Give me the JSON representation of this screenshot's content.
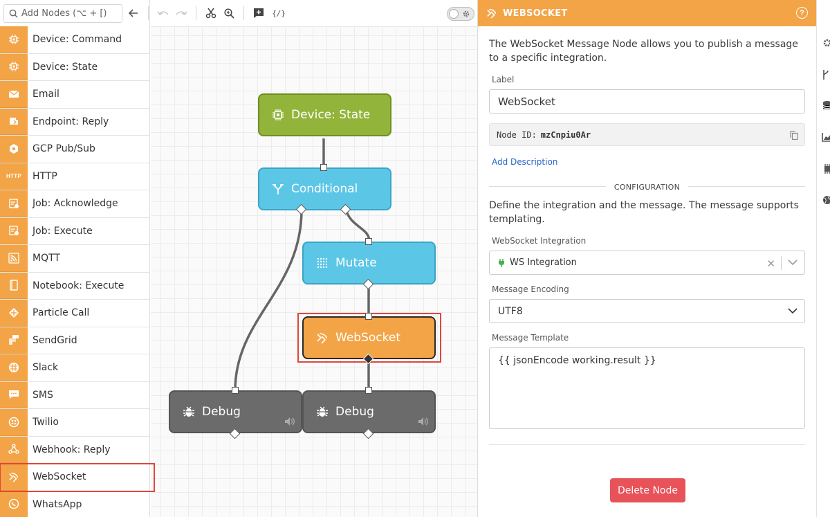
{
  "palette": {
    "search": {
      "placeholder": "Add Nodes (⌥ + [)"
    },
    "items": [
      {
        "label": "Device: Command",
        "icon": "chip-icon"
      },
      {
        "label": "Device: State",
        "icon": "chip-icon"
      },
      {
        "label": "Email",
        "icon": "envelope-icon"
      },
      {
        "label": "Endpoint: Reply",
        "icon": "endpoint-icon"
      },
      {
        "label": "GCP Pub/Sub",
        "icon": "gcp-icon"
      },
      {
        "label": "HTTP",
        "icon": "http-icon"
      },
      {
        "label": "Job: Acknowledge",
        "icon": "job-icon"
      },
      {
        "label": "Job: Execute",
        "icon": "job-icon"
      },
      {
        "label": "MQTT",
        "icon": "rss-icon"
      },
      {
        "label": "Notebook: Execute",
        "icon": "notebook-icon"
      },
      {
        "label": "Particle Call",
        "icon": "particle-icon"
      },
      {
        "label": "SendGrid",
        "icon": "sendgrid-icon"
      },
      {
        "label": "Slack",
        "icon": "slack-icon"
      },
      {
        "label": "SMS",
        "icon": "chat-icon"
      },
      {
        "label": "Twilio",
        "icon": "twilio-icon"
      },
      {
        "label": "Webhook: Reply",
        "icon": "webhook-icon"
      },
      {
        "label": "WebSocket",
        "icon": "websocket-icon"
      },
      {
        "label": "WhatsApp",
        "icon": "whatsapp-icon"
      }
    ],
    "http_icon_text": "HTTP"
  },
  "toolbar": {
    "code_label": "{/}"
  },
  "canvas": {
    "nodes": [
      {
        "label": "Device: State",
        "color": "#93b43a"
      },
      {
        "label": "Conditional",
        "color": "#5bc6e6"
      },
      {
        "label": "Mutate",
        "color": "#5bc6e6"
      },
      {
        "label": "WebSocket",
        "color": "#f3a446"
      },
      {
        "label": "Debug",
        "color": "#6b6b6b"
      },
      {
        "label": "Debug",
        "color": "#6b6b6b"
      }
    ]
  },
  "panel": {
    "header_title": "WEBSOCKET",
    "help_label": "?",
    "description": "The WebSocket Message Node allows you to publish a message to a specific integration.",
    "label_field": {
      "label": "Label",
      "value": "WebSocket"
    },
    "node_id": {
      "label": "Node ID:",
      "value": "mzCnpiu0Ar"
    },
    "add_description": "Add Description",
    "configuration_heading": "CONFIGURATION",
    "config_description": "Define the integration and the message. The message supports templating.",
    "integration_field": {
      "label": "WebSocket Integration",
      "value": "WS Integration",
      "clear": "✕"
    },
    "encoding_field": {
      "label": "Message Encoding",
      "value": "UTF8"
    },
    "template_field": {
      "label": "Message Template",
      "value": "{{ jsonEncode working.result }}"
    },
    "delete_button": "Delete Node"
  },
  "colors": {
    "accent": "#f3a446",
    "danger": "#e85259",
    "link": "#2563c9"
  }
}
